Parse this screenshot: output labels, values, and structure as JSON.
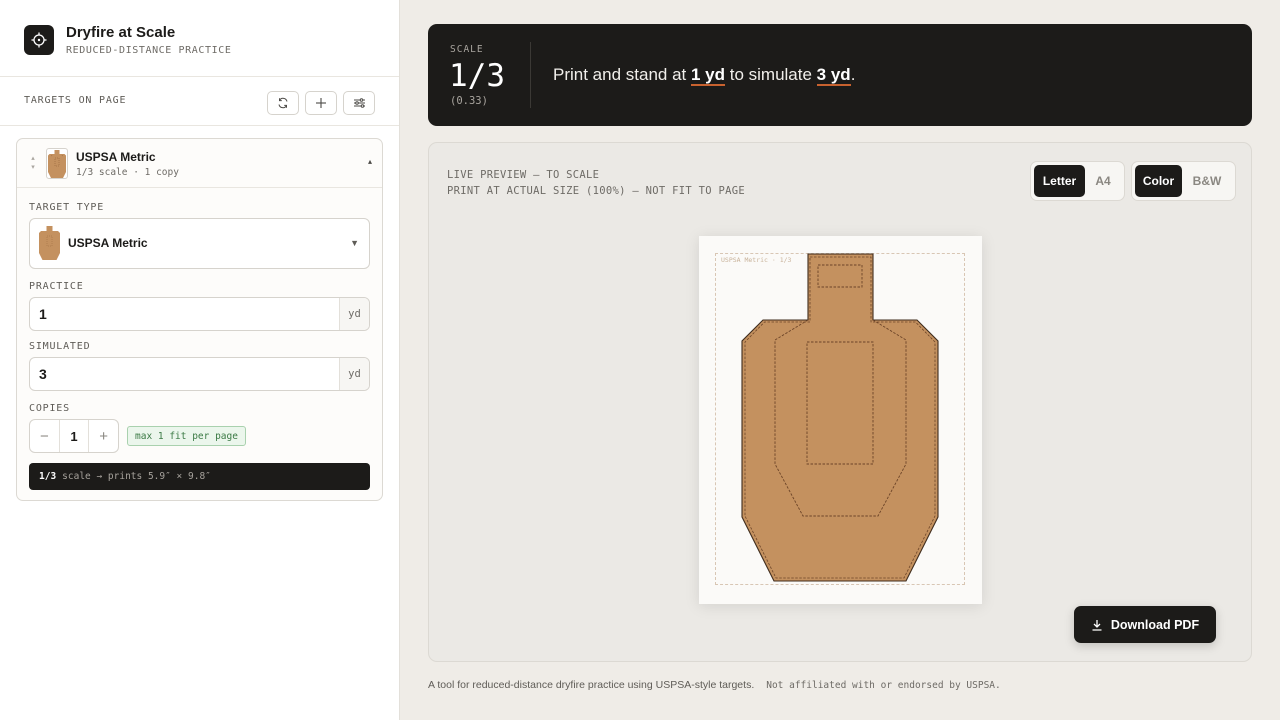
{
  "app": {
    "title": "Dryfire at Scale",
    "subtitle": "REDUCED-DISTANCE PRACTICE",
    "logo_icon": "crosshair-icon"
  },
  "targets_section": {
    "label": "TARGETS ON PAGE",
    "tools": [
      "refresh-icon",
      "plus-icon",
      "sliders-icon"
    ]
  },
  "target_card": {
    "name": "USPSA Metric",
    "summary": "1/3 scale · 1 copy",
    "target_type_label": "TARGET TYPE",
    "target_type_value": "USPSA Metric",
    "practice_label": "PRACTICE",
    "practice_value": "1",
    "practice_unit": "yd",
    "simulated_label": "SIMULATED",
    "simulated_value": "3",
    "simulated_unit": "yd",
    "copies_label": "COPIES",
    "copies_value": "1",
    "decrement": "−",
    "increment": "+",
    "fit_badge": "max 1 fit per page",
    "scale_bold": "1/3",
    "scale_rest": "scale → prints 5.9″ × 9.8″"
  },
  "banner": {
    "label": "SCALE",
    "fraction": "1/3",
    "decimal": "(0.33)",
    "sentence_a": "Print and stand at ",
    "practice_distance": "1 yd",
    "sentence_b": " to simulate ",
    "simulated_distance": "3 yd",
    "sentence_c": "."
  },
  "preview": {
    "caption_line1": "LIVE PREVIEW — TO SCALE",
    "caption_line2": "PRINT AT ACTUAL SIZE (100%) — NOT FIT TO PAGE",
    "paper_sizes": [
      "Letter",
      "A4"
    ],
    "paper_selected": "Letter",
    "color_modes": [
      "Color",
      "B&W"
    ],
    "color_selected": "Color",
    "paper_tag": "USPSA Metric · 1/3",
    "target_color": "#c4915f"
  },
  "download_label": "Download PDF",
  "footer": {
    "text": "A tool for reduced-distance dryfire practice using USPSA-style targets.",
    "note": "Not affiliated with or endorsed by USPSA."
  }
}
